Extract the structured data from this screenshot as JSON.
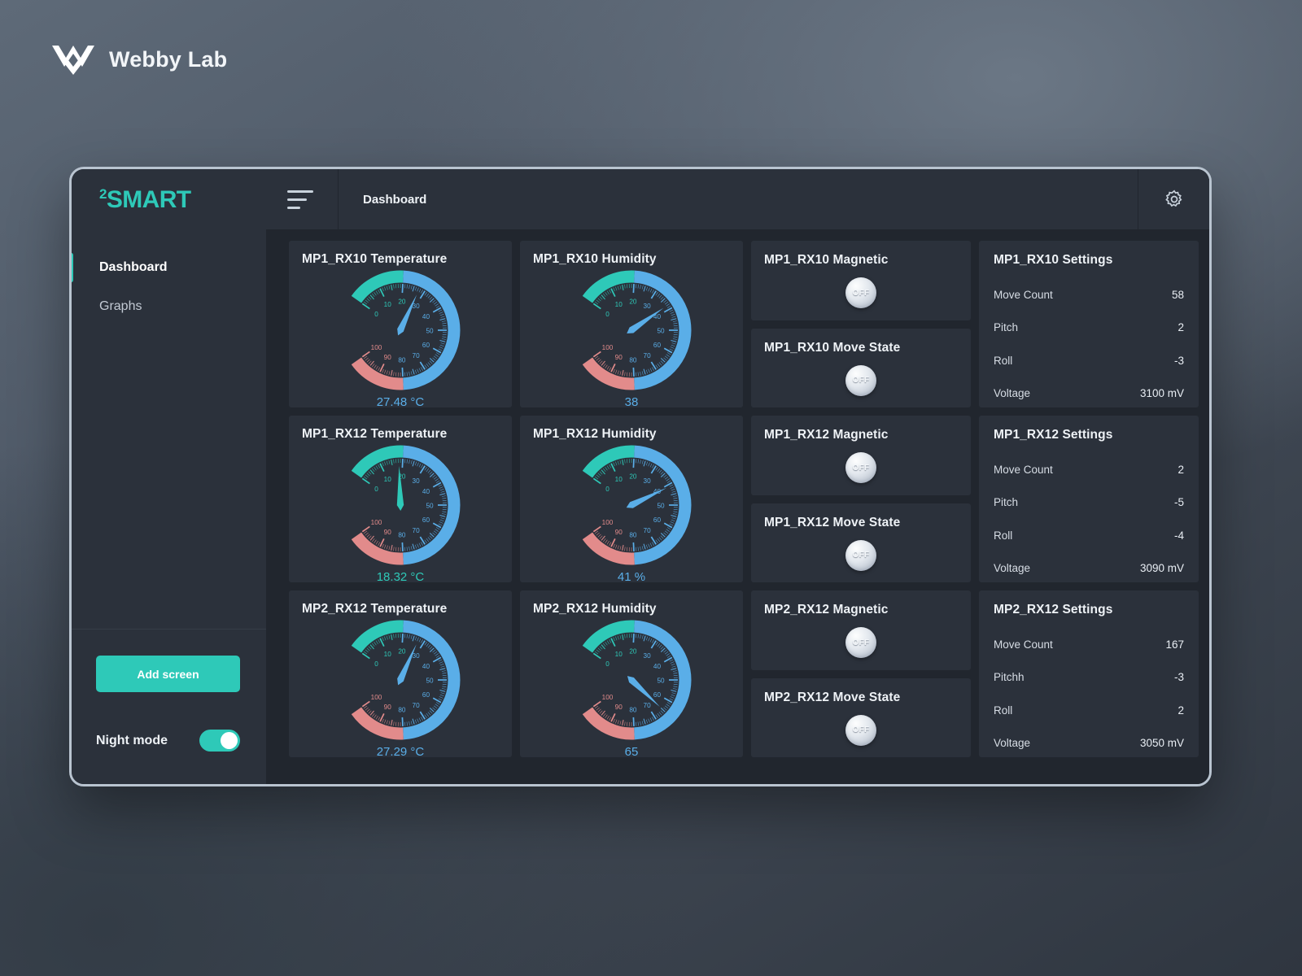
{
  "brand": {
    "name": "Webby Lab",
    "mark_icon": "webbylab-logo-icon"
  },
  "app": {
    "logo_sup": "2",
    "logo_text": "SMART",
    "breadcrumb": "Dashboard",
    "gear_icon": "gear-icon",
    "menu_icon": "hamburger-icon"
  },
  "sidebar": {
    "items": [
      {
        "label": "Dashboard",
        "active": true
      },
      {
        "label": "Graphs",
        "active": false
      }
    ],
    "add_screen_label": "Add screen",
    "night_mode_label": "Night mode",
    "night_mode_on": true
  },
  "colors": {
    "accent_teal": "#2ec9b8",
    "gauge_blue": "#5aaee8",
    "gauge_green": "#2ec9b8",
    "gauge_red": "#e28b8b",
    "panel": "#2b313b",
    "canvas": "#21262e"
  },
  "gauge_scale": {
    "min": 0,
    "max": 100,
    "ticks": [
      0,
      10,
      20,
      30,
      40,
      50,
      60,
      70,
      80,
      90,
      100
    ],
    "zones": [
      {
        "from": 0,
        "to": 20,
        "color": "#2ec9b8"
      },
      {
        "from": 20,
        "to": 80,
        "color": "#5aaee8"
      },
      {
        "from": 80,
        "to": 100,
        "color": "#e28b8b"
      }
    ]
  },
  "gauges": [
    {
      "title": "MP1_RX10 Temperature",
      "value": 27.48,
      "display": "27.48 °C",
      "needle": "blue",
      "value_color": "blue"
    },
    {
      "title": "MP1_RX10 Humidity",
      "value": 38,
      "display": "38",
      "needle": "blue",
      "value_color": "blue"
    },
    {
      "title": "MP1_RX12 Temperature",
      "value": 18.32,
      "display": "18.32 °C",
      "needle": "teal",
      "value_color": "teal"
    },
    {
      "title": "MP1_RX12 Humidity",
      "value": 41,
      "display": "41 %",
      "needle": "blue",
      "value_color": "blue"
    },
    {
      "title": "MP2_RX12 Temperature",
      "value": 27.29,
      "display": "27.29 °C",
      "needle": "blue",
      "value_color": "blue"
    },
    {
      "title": "MP2_RX12 Humidity",
      "value": 65,
      "display": "65",
      "needle": "blue",
      "value_color": "blue"
    }
  ],
  "toggles": [
    {
      "title": "MP1_RX10 Magnetic",
      "state": "OFF"
    },
    {
      "title": "MP1_RX10 Move State",
      "state": "OFF"
    },
    {
      "title": "MP1_RX12 Magnetic",
      "state": "OFF"
    },
    {
      "title": "MP1_RX12 Move State",
      "state": "OFF"
    },
    {
      "title": "MP2_RX12 Magnetic",
      "state": "OFF"
    },
    {
      "title": "MP2_RX12 Move State",
      "state": "OFF"
    }
  ],
  "settings_panels": [
    {
      "title": "MP1_RX10 Settings",
      "rows": [
        {
          "key": "Move Count",
          "value": "58"
        },
        {
          "key": "Pitch",
          "value": "2"
        },
        {
          "key": "Roll",
          "value": "-3"
        },
        {
          "key": "Voltage",
          "value": "3100 mV"
        }
      ]
    },
    {
      "title": "MP1_RX12 Settings",
      "rows": [
        {
          "key": "Move Count",
          "value": "2"
        },
        {
          "key": "Pitch",
          "value": "-5"
        },
        {
          "key": "Roll",
          "value": "-4"
        },
        {
          "key": "Voltage",
          "value": "3090 mV"
        }
      ]
    },
    {
      "title": "MP2_RX12 Settings",
      "rows": [
        {
          "key": "Move Count",
          "value": "167"
        },
        {
          "key": "Pitchh",
          "value": "-3"
        },
        {
          "key": "Roll",
          "value": "2"
        },
        {
          "key": "Voltage",
          "value": "3050 mV"
        }
      ]
    }
  ]
}
